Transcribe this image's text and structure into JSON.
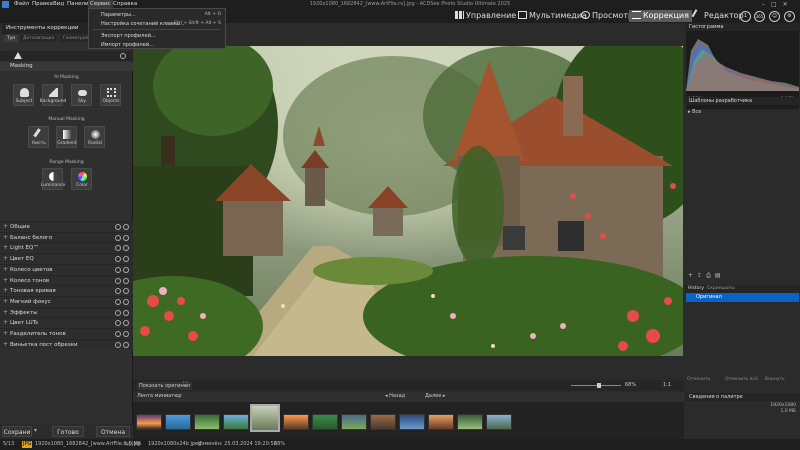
{
  "menubar": {
    "items": [
      "Файл",
      "Правка",
      "Вид",
      "Панели",
      "Сервис",
      "Справка"
    ],
    "title": "1920x1080_1682842_[www.ArtFile.ru].jpg - ACDSee Photo Studio Ultimate 2025"
  },
  "modes": {
    "manage": "Управление",
    "media": "Мультимедиа",
    "view": "Просмотр",
    "develop": "Коррекция",
    "edit": "Редактор",
    "icons": [
      "1",
      "365",
      "person-icon",
      "gear-icon"
    ]
  },
  "dropdown": {
    "items": [
      {
        "label": "Параметры...",
        "shortcut": "Alt + O"
      },
      {
        "label": "Настройка сочетаний клавиш...",
        "shortcut": "Ctrl + Shift + Alt + S"
      },
      {
        "label": "Экспорт профилей...",
        "shortcut": ""
      },
      {
        "label": "Импорт профилей...",
        "shortcut": ""
      }
    ]
  },
  "leftpanel": {
    "header": "Инструменты коррекции",
    "tabs": [
      "Тун",
      "Детализация",
      "Геометрия"
    ],
    "masking_title": "Masking",
    "ai_masking": "AI Masking",
    "ai_buttons": [
      "Subject",
      "Background",
      "Sky",
      "Objects"
    ],
    "manual_masking": "Manual Masking",
    "manual_buttons": [
      "Кисть",
      "Gradient",
      "Radial"
    ],
    "range_masking": "Range Masking",
    "range_buttons": [
      "Luminance",
      "Color"
    ],
    "groups": [
      "Общие",
      "Баланс белого",
      "Light EQ™",
      "Цвет EQ",
      "Колесо цветов",
      "Колесо тонов",
      "Тоновая кривая",
      "Мягкий фокус",
      "Эффекты",
      "Цвет LUTs",
      "Разделитель тонов",
      "Виньетка пост обрезки"
    ],
    "buttons": {
      "save": "Сохрани",
      "done": "Готово",
      "cancel": "Отмена"
    }
  },
  "viewbar": {
    "show_original": "Показать оригинал",
    "zoom": "68%",
    "ratio": "1:1"
  },
  "filmstrip": {
    "title": "Лента миниатюр",
    "back": "Назад",
    "forward": "Далее"
  },
  "rightpanel": {
    "histogram_title": "Гистограмма",
    "histo_left": "0,38%",
    "histo_right": "0,06%",
    "presets_title": "Шаблоны разработчика",
    "presets_all": "Все",
    "history_tab": "History",
    "snapshots_tab": "Скриншоты",
    "history_item": "Оригинал",
    "history_buttons": [
      "Отменить",
      "Отменить всё",
      "Вернуть"
    ],
    "info_title": "Сведения о палитре",
    "info_values": [
      "1920x1080",
      "1,0 МБ"
    ]
  },
  "status": {
    "index": "5/13",
    "format": "JPG",
    "filename": "1920x1080_1682842_[www.ArtFile.ru].jpg",
    "size": "1,0 МБ",
    "dims": "1920x1080x24b jpeg",
    "modified": "Изменён: 25.03.2024 19:20:52",
    "zoom": "68%"
  },
  "colors": {
    "accent": "#0a64c8",
    "panel": "#2f2f2f",
    "active_mode": "#5a5a5a"
  }
}
